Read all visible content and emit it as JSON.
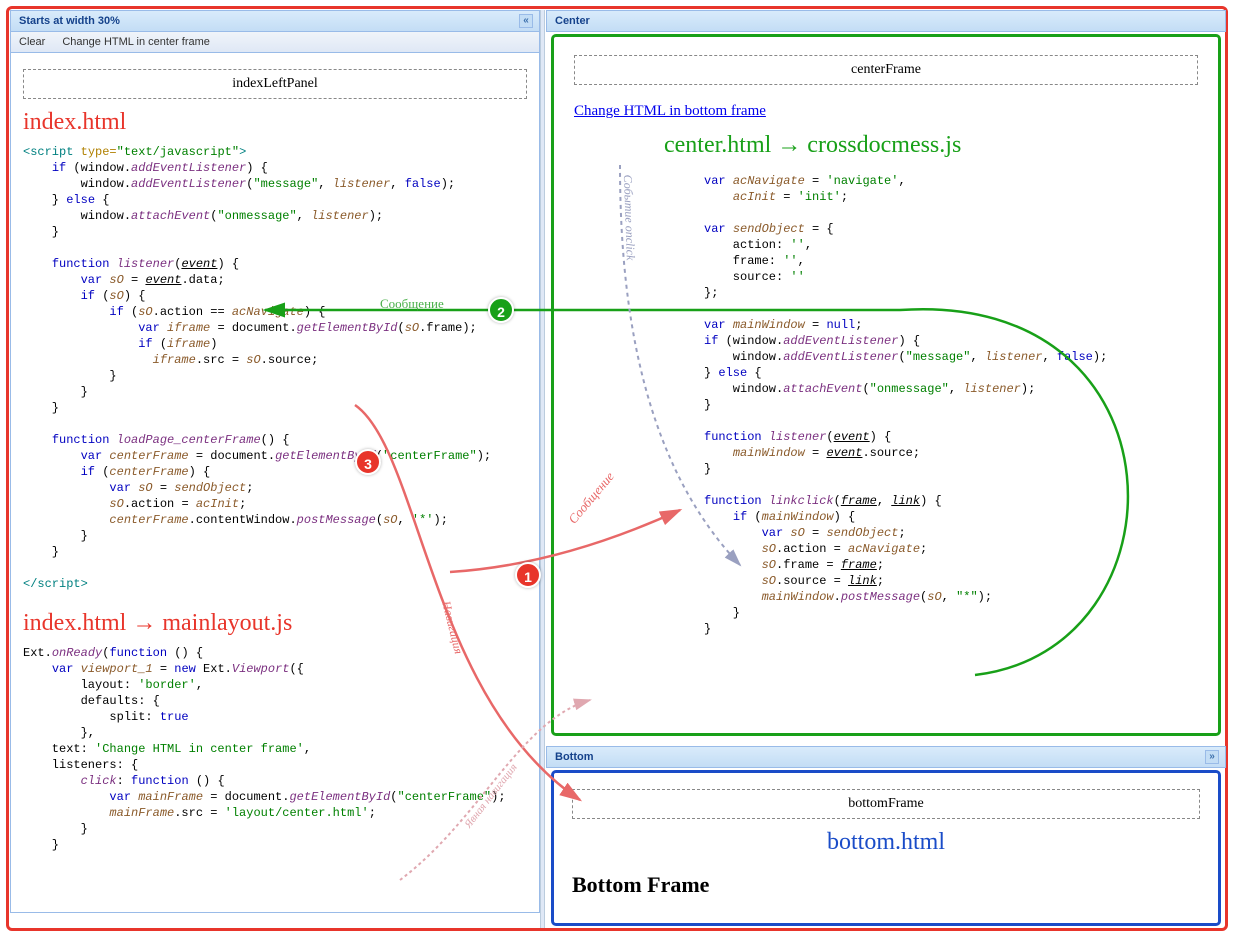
{
  "left": {
    "header": "Starts at width 30%",
    "toolbar": {
      "clear": "Clear",
      "change": "Change HTML in center frame"
    },
    "boxLabel": "indexLeftPanel",
    "title1": "index.html",
    "title2": "index.html  →  mainlayout.js",
    "code1": "<script type=\"text/javascript\">\n    if (window.addEventListener) {\n        window.addEventListener(\"message\", listener, false);\n    } else {\n        window.attachEvent(\"onmessage\", listener);\n    }\n\n    function listener(event) {\n        var sO = event.data;\n        if (sO) {\n            if (sO.action == acNavigate) {\n                var iframe = document.getElementById(sO.frame);\n                if (iframe)\n                  iframe.src = sO.source;\n            }\n        }\n    }\n\n    function loadPage_centerFrame() {\n        var centerFrame = document.getElementById(\"centerFrame\");\n        if (centerFrame) {\n            var sO = sendObject;\n            sO.action = acInit;\n            centerFrame.contentWindow.postMessage(sO, '*');\n        }\n    }\n\n</script>",
    "code2": "Ext.onReady(function () {\n    var viewport_1 = new Ext.Viewport({\n        layout: 'border',\n        defaults: {\n            split: true\n        },\n    text: 'Change HTML in center frame',\n    listeners: {\n        click: function () {\n            var mainFrame = document.getElementById(\"centerFrame\");\n            mainFrame.src = 'layout/center.html';\n        }\n    }"
  },
  "center": {
    "header": "Center",
    "boxLabel": "centerFrame",
    "link": "Change HTML in bottom frame",
    "title": "center.html  →  crossdocmess.js",
    "code": "var acNavigate = 'navigate',\n    acInit = 'init';\n\nvar sendObject = {\n    action: '',\n    frame: '',\n    source: ''\n};\n\nvar mainWindow = null;\nif (window.addEventListener) {\n    window.addEventListener(\"message\", listener, false);\n} else {\n    window.attachEvent(\"onmessage\", listener);\n}\n\nfunction listener(event) {\n    mainWindow = event.source;\n}\n\nfunction linkclick(frame, link) {\n    if (mainWindow) {\n        var sO = sendObject;\n        sO.action = acNavigate;\n        sO.frame = frame;\n        sO.source = link;\n        mainWindow.postMessage(sO, \"*\");\n    }\n}"
  },
  "bottom": {
    "header": "Bottom",
    "boxLabel": "bottomFrame",
    "title": "bottom.html",
    "heading": "Bottom Frame"
  },
  "labels": {
    "msg1": "Сообщение",
    "msg2": "Сообщение",
    "event": "Событие onclick",
    "nav": "Навигация",
    "explicit": "Явная навигация"
  },
  "badges": {
    "b1": "1",
    "b2": "2",
    "b3": "3"
  }
}
